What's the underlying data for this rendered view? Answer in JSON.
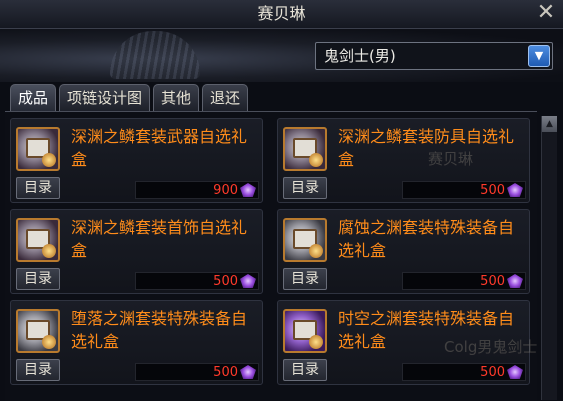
{
  "window": {
    "title": "赛贝琳"
  },
  "job_select": {
    "value": "鬼剑士(男)"
  },
  "tabs": [
    "成品",
    "项链设计图",
    "其他",
    "退还"
  ],
  "items": [
    {
      "name": "深渊之鳞套装武器自选礼盒",
      "catalog": "目录",
      "price": "900"
    },
    {
      "name": "深渊之鳞套装防具自选礼盒",
      "catalog": "目录",
      "price": "500"
    },
    {
      "name": "深渊之鳞套装首饰自选礼盒",
      "catalog": "目录",
      "price": "500"
    },
    {
      "name": "腐蚀之渊套装特殊装备自选礼盒",
      "catalog": "目录",
      "price": "500"
    },
    {
      "name": "堕落之渊套装特殊装备自选礼盒",
      "catalog": "目录",
      "price": "500"
    },
    {
      "name": "时空之渊套装特殊装备自选礼盒",
      "catalog": "目录",
      "price": "500"
    }
  ],
  "colors": {
    "item_name": "#ff8c1a",
    "price": "#ff3a2a",
    "accent": "#2f6fd0"
  },
  "watermarks": [
    "赛贝琳",
    "Colg男鬼剑士"
  ]
}
